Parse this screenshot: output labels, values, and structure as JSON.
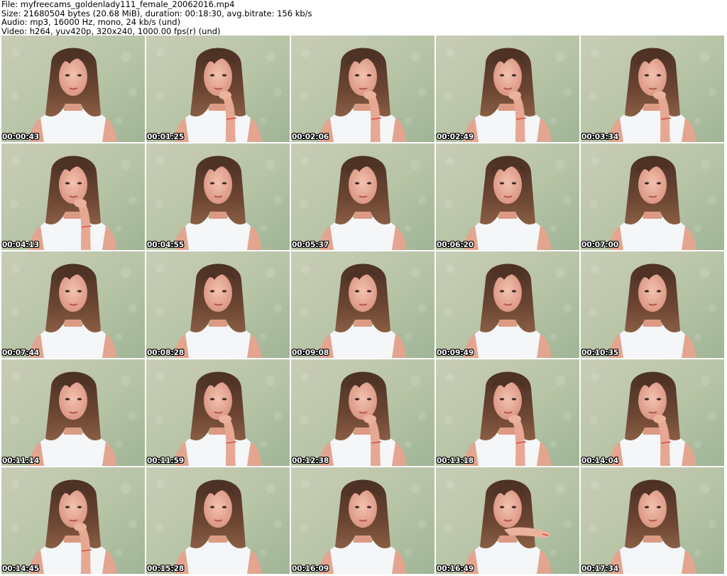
{
  "header": {
    "file_line": "File: myfreecams_goldenlady111_female_20062016.mp4",
    "size_line": "Size: 21680504 bytes (20.68 MiB), duration: 00:18:30, avg.bitrate: 156 kb/s",
    "audio_line": "Audio: mp3, 16000 Hz, mono, 24 kb/s (und)",
    "video_line": "Video: h264, yuv420p, 320x240, 1000.00 fps(r) (und)"
  },
  "frames": [
    {
      "timestamp": "00:00:43",
      "pose": "straight"
    },
    {
      "timestamp": "00:01:25",
      "pose": "hand-chin"
    },
    {
      "timestamp": "00:02:06",
      "pose": "hand-chin"
    },
    {
      "timestamp": "00:02:49",
      "pose": "hand-chin"
    },
    {
      "timestamp": "00:03:34",
      "pose": "hand-chin"
    },
    {
      "timestamp": "00:04:13",
      "pose": "hand-chin"
    },
    {
      "timestamp": "00:04:55",
      "pose": "straight"
    },
    {
      "timestamp": "00:05:37",
      "pose": "straight"
    },
    {
      "timestamp": "00:06:20",
      "pose": "straight"
    },
    {
      "timestamp": "00:07:00",
      "pose": "straight"
    },
    {
      "timestamp": "00:07:44",
      "pose": "straight"
    },
    {
      "timestamp": "00:08:28",
      "pose": "straight"
    },
    {
      "timestamp": "00:09:08",
      "pose": "straight"
    },
    {
      "timestamp": "00:09:49",
      "pose": "straight"
    },
    {
      "timestamp": "00:10:35",
      "pose": "straight"
    },
    {
      "timestamp": "00:11:14",
      "pose": "straight"
    },
    {
      "timestamp": "00:11:59",
      "pose": "hand-chin"
    },
    {
      "timestamp": "00:12:38",
      "pose": "hand-chin"
    },
    {
      "timestamp": "00:13:18",
      "pose": "hand-chin"
    },
    {
      "timestamp": "00:14:04",
      "pose": "hand-chin"
    },
    {
      "timestamp": "00:14:45",
      "pose": "hand-chin"
    },
    {
      "timestamp": "00:15:28",
      "pose": "straight"
    },
    {
      "timestamp": "00:16:09",
      "pose": "straight"
    },
    {
      "timestamp": "00:16:49",
      "pose": "hand-mouth"
    },
    {
      "timestamp": "00:17:34",
      "pose": "straight"
    }
  ]
}
